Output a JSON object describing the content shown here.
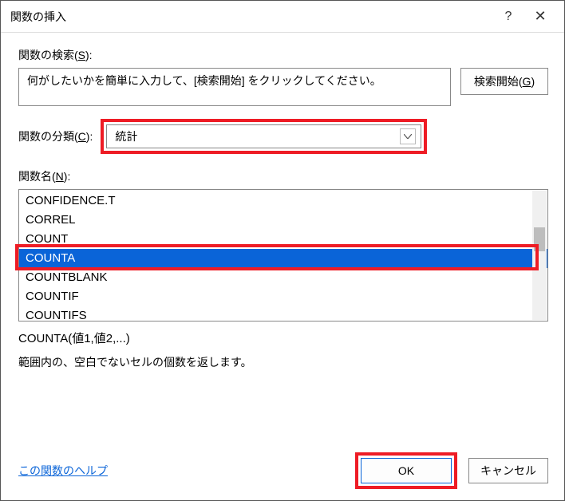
{
  "titlebar": {
    "title": "関数の挿入",
    "help_symbol": "?",
    "close_symbol": "✕"
  },
  "labels": {
    "search_prefix": "関数の検索(",
    "search_key": "S",
    "search_suffix": "):",
    "category_prefix": "関数の分類(",
    "category_key": "C",
    "category_suffix": "):",
    "funcname_prefix": "関数名(",
    "funcname_key": "N",
    "funcname_suffix": "):"
  },
  "search": {
    "text": "何がしたいかを簡単に入力して、[検索開始] をクリックしてください。",
    "button_label_prefix": "検索開始(",
    "button_key": "G",
    "button_label_suffix": ")"
  },
  "category": {
    "selected": "統計"
  },
  "functions": {
    "items": [
      "CONFIDENCE.T",
      "CORREL",
      "COUNT",
      "COUNTA",
      "COUNTBLANK",
      "COUNTIF",
      "COUNTIFS"
    ],
    "selected_index": 3
  },
  "detail": {
    "signature": "COUNTA(値1,値2,...)",
    "description": "範囲内の、空白でないセルの個数を返します。"
  },
  "footer": {
    "help_link": "この関数のヘルプ",
    "ok": "OK",
    "cancel": "キャンセル"
  }
}
